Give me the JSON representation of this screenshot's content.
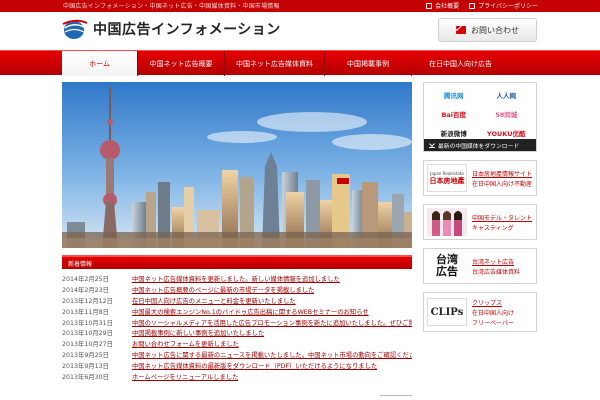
{
  "header": {
    "tagline": "中国広告インフォメーション・中国ネット広告・中国媒体資料・中国市場情報",
    "links": [
      {
        "label": "会社概要",
        "icon": "building-icon"
      },
      {
        "label": "プライバシーポリシー",
        "icon": "shield-icon"
      }
    ],
    "site_title": "中国広告インフォメーション",
    "contact_label": "お問い合わせ"
  },
  "nav": {
    "items": [
      {
        "label": "ホーム",
        "active": true
      },
      {
        "label": "中国ネット広告概要",
        "active": false
      },
      {
        "label": "中国ネット広告媒体資料",
        "active": false
      },
      {
        "label": "中国掲載事例",
        "active": false
      },
      {
        "label": "在日中国人向け広告",
        "active": false
      }
    ]
  },
  "hero": {
    "alt": ""
  },
  "news": {
    "header": "新着情報",
    "items": [
      {
        "date": "2014年2月25日",
        "title": "中国ネット広告媒体資料を更新しました。新しい媒体情報を追加しました"
      },
      {
        "date": "2014年2月23日",
        "title": "中国ネット広告概要のページに最新の市場データを掲載しました"
      },
      {
        "date": "2013年12月12日",
        "title": "在日中国人向け広告のメニューと料金を更新いたしました"
      },
      {
        "date": "2013年11月8日",
        "title": "中国最大の検索エンジンNo.1のバイドゥ広告出稿に関するWEBセミナーのお知らせ"
      },
      {
        "date": "2013年10月31日",
        "title": "中国のソーシャルメディアを活用した広告プロモーション事例を新たに追加いたしました。ぜひご覧ください"
      },
      {
        "date": "2013年10月29日",
        "title": "中国掲載事例に新しい事例を追加いたしました"
      },
      {
        "date": "2013年10月27日",
        "title": "お問い合わせフォームを更新しました"
      },
      {
        "date": "2013年9月25日",
        "title": "中国ネット広告に関する最新のニュースを掲載いたしました。中国ネット市場の動向をご確認ください"
      },
      {
        "date": "2013年9月13日",
        "title": "中国ネット広告媒体資料の最新版をダウンロード（PDF）いただけるようになりました"
      },
      {
        "date": "2013年6月30日",
        "title": "ホームページをリニューアルしました"
      }
    ]
  },
  "sidebar": {
    "brands": [
      {
        "name": "腾讯网",
        "color": "#1a8cd8"
      },
      {
        "name": "人人网",
        "color": "#1e4fa3"
      },
      {
        "name": "Bai百度",
        "color": "#d8121b"
      },
      {
        "name": "58同城",
        "color": "#e45b8a"
      },
      {
        "name": "新浪微博",
        "color": "#222222"
      },
      {
        "name": "YOUKU优酷",
        "color": "#d8121b"
      }
    ],
    "download_label": "最新の中国媒体をダウンロード",
    "cards": [
      {
        "img_line1": "Japan Realestate",
        "img_line2": "日本房地產",
        "title": "日本房地產情報サイト",
        "sub": "在日中国人向け不動産"
      },
      {
        "img_line1": "",
        "img_line2": "",
        "title": "中国モデル・タレント",
        "sub": "キャスティング"
      },
      {
        "img_line1": "台湾",
        "img_line2": "広告",
        "title": "台湾ネット広告",
        "sub": "台湾広告媒体資料"
      },
      {
        "img_line1": "CLIPs",
        "img_line2": "",
        "title": "クリップス",
        "sub": "在日中国人向け",
        "sub2": "フリーペーパー"
      }
    ]
  },
  "colors": {
    "brand_red": "#c40000",
    "link_red": "#a00000"
  }
}
